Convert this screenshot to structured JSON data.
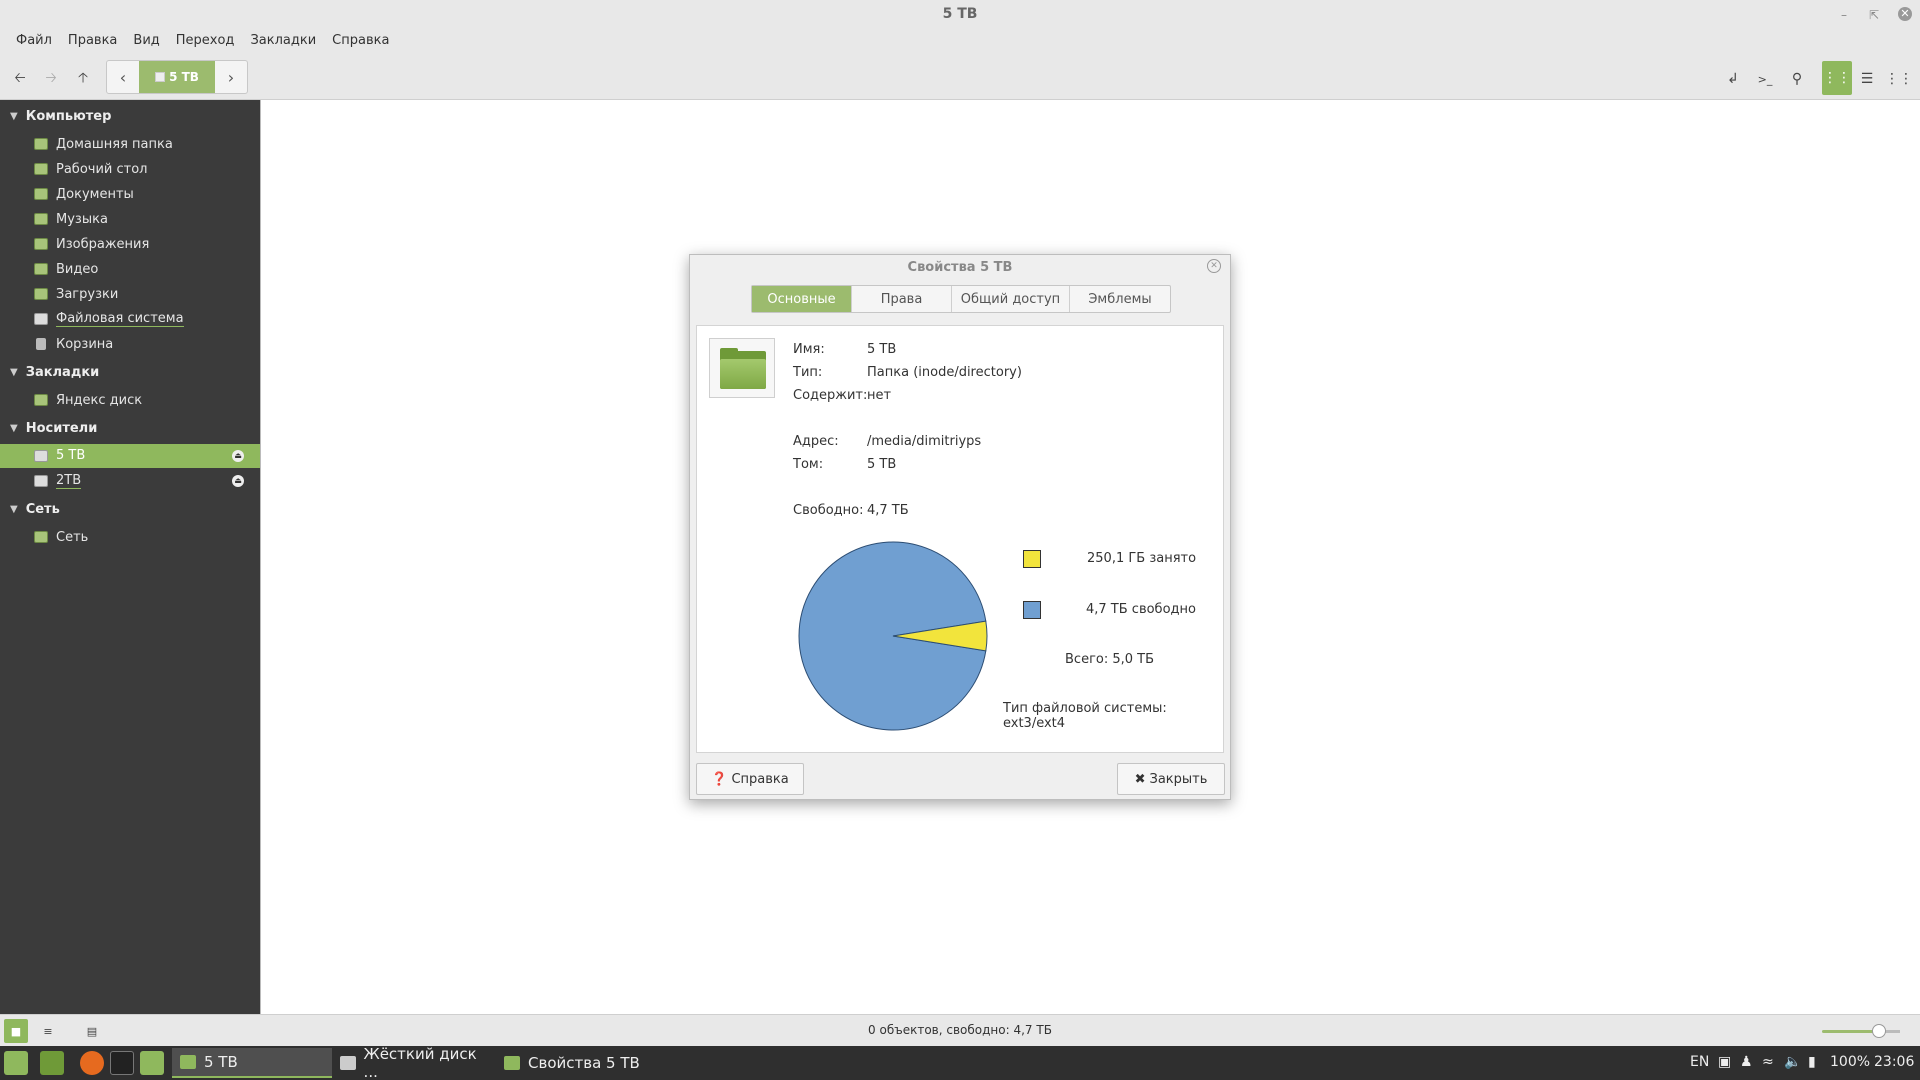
{
  "window": {
    "title": "5 ТВ"
  },
  "menu": [
    "Файл",
    "Правка",
    "Вид",
    "Переход",
    "Закладки",
    "Справка"
  ],
  "breadcrumb": {
    "current": "5 ТВ"
  },
  "sidebar": {
    "sections": [
      {
        "label": "Компьютер",
        "items": [
          "Домашняя папка",
          "Рабочий стол",
          "Документы",
          "Музыка",
          "Изображения",
          "Видео",
          "Загрузки",
          "Файловая система",
          "Корзина"
        ]
      },
      {
        "label": "Закладки",
        "items": [
          "Яндекс диск"
        ]
      },
      {
        "label": "Носители",
        "items": [
          "5 ТВ",
          "2ТВ"
        ]
      },
      {
        "label": "Сеть",
        "items": [
          "Сеть"
        ]
      }
    ]
  },
  "status": {
    "text": "0 объектов, свободно: 4,7 ТБ"
  },
  "dialog": {
    "title": "Свойства 5 ТВ",
    "tabs": [
      "Основные",
      "Права",
      "Общий доступ",
      "Эмблемы"
    ],
    "fields": {
      "name_label": "Имя:",
      "name_value": "5 ТВ",
      "type_label": "Тип:",
      "type_value": "Папка (inode/directory)",
      "contains_label": "Содержит:",
      "contains_value": "нет",
      "address_label": "Адрес:",
      "address_value": "/media/dimitriyps",
      "volume_label": "Том:",
      "volume_value": "5 ТВ",
      "free_label": "Свободно:",
      "free_value": "4,7 ТБ"
    },
    "usage": {
      "used_label": "250,1 ГБ занято",
      "free_label": "4,7 ТБ свободно",
      "total": "Всего: 5,0 ТБ",
      "fs_type": "Тип файловой системы: ext3/ext4",
      "used_color": "#f2e43c",
      "free_color": "#709fd1"
    },
    "help_button": "Справка",
    "close_button": "Закрыть"
  },
  "chart_data": {
    "type": "pie",
    "categories": [
      "250,1 ГБ занято",
      "4,7 ТБ свободно"
    ],
    "values": [
      250.1,
      4700
    ],
    "colors": [
      "#f2e43c",
      "#709fd1"
    ]
  },
  "taskbar": {
    "tasks": [
      "5 ТВ",
      "Жёсткий диск ...",
      "Свойства 5 ТВ"
    ],
    "lang": "EN",
    "battery": "100%",
    "clock": "23:06"
  }
}
